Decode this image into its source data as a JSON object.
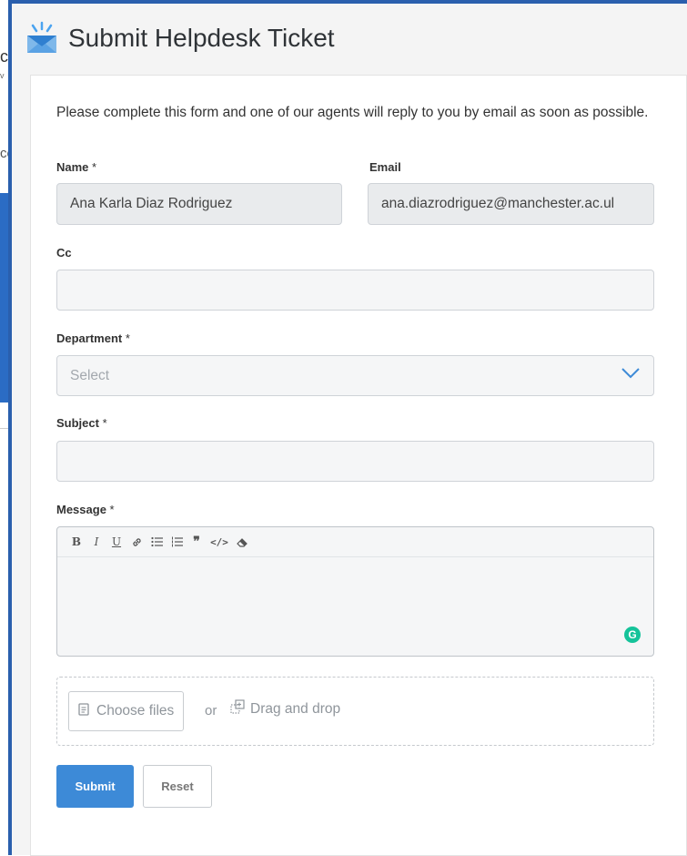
{
  "background": {
    "fragment_c": "c",
    "fragment_v": "v",
    "fragment_ce": "ce"
  },
  "modal": {
    "title": "Submit Helpdesk Ticket",
    "icon": "mail-icon"
  },
  "form": {
    "intro": "Please complete this form and one of our agents will reply to you by email as soon as possible.",
    "name_label": "Name",
    "name_value": "Ana Karla Diaz Rodriguez",
    "email_label": "Email",
    "email_value": "ana.diazrodriguez@manchester.ac.ul",
    "cc_label": "Cc",
    "cc_value": "",
    "department_label": "Department",
    "department_placeholder": "Select",
    "subject_label": "Subject",
    "subject_value": "",
    "message_label": "Message",
    "required_mark": "*",
    "toolbar": {
      "bold": "B",
      "italic": "I",
      "underline": "U",
      "link": "link-icon",
      "bullet_list": "bullet-list-icon",
      "numbered_list": "numbered-list-icon",
      "quote": "quote-icon",
      "code": "</>",
      "clear_format": "eraser-icon"
    },
    "grammarly_badge": "G",
    "attachments": {
      "choose_label": "Choose files",
      "or_label": "or",
      "drag_label": "Drag and drop"
    },
    "submit_label": "Submit",
    "reset_label": "Reset"
  },
  "colors": {
    "modal_border": "#2a5fad",
    "accent": "#3d8ad7",
    "grammarly": "#15c39a"
  }
}
